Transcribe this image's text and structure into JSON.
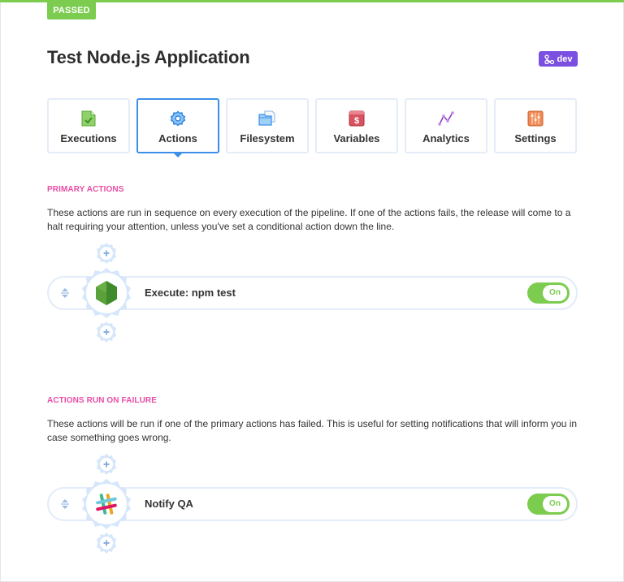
{
  "status": {
    "label": "PASSED",
    "color": "#7ccc4f"
  },
  "header": {
    "title": "Test Node.js Application",
    "environment": {
      "label": "dev",
      "icon": "branch-icon",
      "color": "#7b4fe0"
    }
  },
  "tabs": [
    {
      "label": "Executions",
      "icon": "document-check-icon",
      "active": false
    },
    {
      "label": "Actions",
      "icon": "gear-icon",
      "active": true
    },
    {
      "label": "Filesystem",
      "icon": "folder-icon",
      "active": false
    },
    {
      "label": "Variables",
      "icon": "dollar-icon",
      "active": false
    },
    {
      "label": "Analytics",
      "icon": "line-chart-icon",
      "active": false
    },
    {
      "label": "Settings",
      "icon": "sliders-icon",
      "active": false
    }
  ],
  "primary": {
    "heading": "PRIMARY ACTIONS",
    "description": "These actions are run in sequence on every execution of the pipeline. If one of the actions fails, the release will come to a halt requiring your attention, unless you've set a conditional action down the line.",
    "actions": [
      {
        "name": "Execute: npm test",
        "icon": "nodejs-icon",
        "toggle": "On",
        "enabled": true
      }
    ]
  },
  "failure": {
    "heading": "ACTIONS RUN ON FAILURE",
    "description": "These actions will be run if one of the primary actions has failed. This is useful for setting notifications that will inform you in case something goes wrong.",
    "actions": [
      {
        "name": "Notify QA",
        "icon": "slack-icon",
        "toggle": "On",
        "enabled": true
      }
    ]
  },
  "colors": {
    "accent": "#3b8fe8",
    "section": "#e84da6",
    "success": "#7ccc4f",
    "gear": "#d6e6fb"
  }
}
